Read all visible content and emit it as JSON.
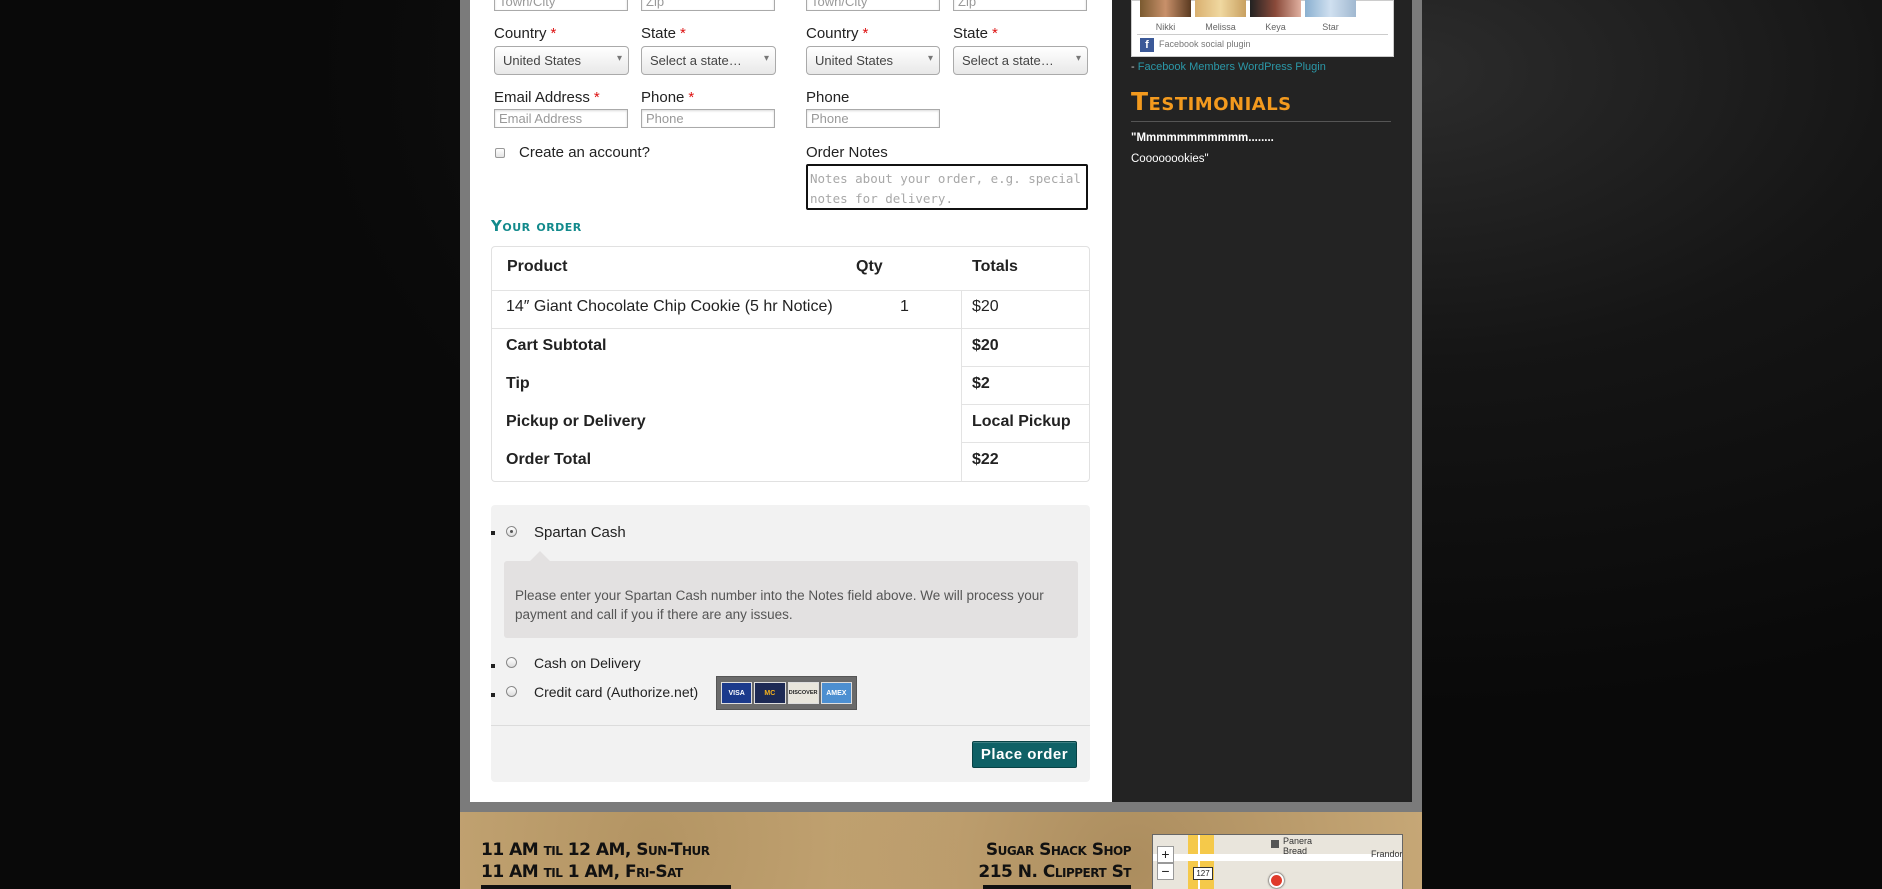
{
  "billing": {
    "city_placeholder": "Town/City",
    "zip_placeholder": "Zip",
    "country_label": "Country",
    "country_value": "United States",
    "state_label": "State",
    "state_value": "Select a state…",
    "email_label": "Email Address",
    "email_placeholder": "Email Address",
    "phone_label": "Phone",
    "phone_placeholder": "Phone",
    "required_mark": "*",
    "create_account_label": "Create an account?"
  },
  "shipping": {
    "city_placeholder": "Town/City",
    "zip_placeholder": "Zip",
    "country_label": "Country",
    "country_value": "United States",
    "state_label": "State",
    "state_value": "Select a state…",
    "phone_label": "Phone",
    "phone_placeholder": "Phone",
    "notes_label": "Order Notes",
    "notes_placeholder": "Notes about your order, e.g. special notes for delivery."
  },
  "order": {
    "heading": "Your order",
    "col_product": "Product",
    "col_qty": "Qty",
    "col_totals": "Totals",
    "item_name": "14″ Giant Chocolate Chip Cookie (5 hr Notice)",
    "item_qty": "1",
    "item_total": "$20",
    "subtotal_label": "Cart Subtotal",
    "subtotal_value": "$20",
    "tip_label": "Tip",
    "tip_value": "$2",
    "pickup_label": "Pickup or Delivery",
    "pickup_value": "Local Pickup",
    "total_label": "Order Total",
    "total_value": "$22"
  },
  "payment": {
    "spartan_label": "Spartan Cash",
    "spartan_desc": "Please enter your Spartan Cash number into the Notes field above. We will process your payment and call if you if there are any issues.",
    "cod_label": "Cash on Delivery",
    "cc_label": "Credit card (Authorize.net)",
    "cards": [
      "VISA",
      "MC",
      "DISCOVER",
      "AMEX"
    ],
    "place_order": "Place order"
  },
  "sidebar": {
    "members": [
      "Nikki",
      "Melissa",
      "Keya",
      "Star"
    ],
    "fb_plugin": "Facebook social plugin",
    "dash": "-",
    "members_plugin_link": "Facebook Members WordPress Plugin",
    "testimonials_heading": "Testimonials",
    "testimonial_line1": "\"Mmmmmmmmmmm........",
    "testimonial_line2": "Coooooookies\""
  },
  "footer": {
    "hours1": "11 AM til 12 AM, Sun-Thur",
    "hours2": "11 AM til 1 AM, Fri-Sat",
    "shop_name": "Sugar Shack Shop",
    "address": "215 N. Clippert St",
    "map_label1": "Panera Bread",
    "map_label2": "Frandor",
    "map_route": "127",
    "zoom_in": "+",
    "zoom_out": "−"
  },
  "colors": {
    "accent": "#0f6166",
    "testimonial_heading": "#f39a1e",
    "link": "#2b98a8",
    "order_heading": "#128a8c"
  }
}
